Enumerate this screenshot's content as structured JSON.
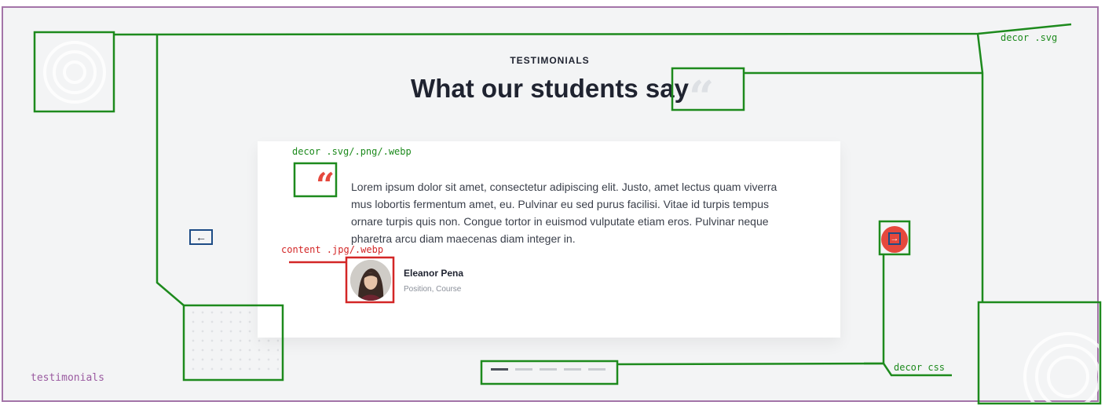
{
  "section": {
    "eyebrow": "TESTIMONIALS",
    "heading": "What our students say",
    "label": "testimonials"
  },
  "testimonial": {
    "quote_mark": "“",
    "text": "Lorem ipsum dolor sit amet, consectetur adipiscing elit. Justo, amet lectus quam viverra mus lobortis fermentum amet, eu. Pulvinar eu sed purus facilisi. Vitae id turpis tempus ornare turpis quis non. Congue tortor in euismod vulputate etiam eros. Pulvinar neque pharetra arcu diam maecenas diam integer in.",
    "author_name": "Eleanor Pena",
    "author_role": "Position, Course"
  },
  "nav": {
    "prev_icon": "←",
    "next_icon": "→"
  },
  "pager": {
    "count": 5,
    "active_index": 0
  },
  "annotations": {
    "decor_svg": "decor .svg",
    "decor_svg_png_webp": "decor .svg/.png/.webp",
    "content_jpg_webp": "content .jpg/.webp",
    "decor_css": "decor css"
  },
  "icons": {
    "ring_decor": "concentric-rings-icon",
    "quote_decor": "quote-icon",
    "dot_grid": "dot-grid-pattern",
    "arrow_left": "arrow-left-icon",
    "arrow_right": "arrow-right-icon"
  },
  "colors": {
    "accent": "#e5483d",
    "heading": "#1f2330",
    "body_text": "#3a3f4a",
    "muted_text": "#8a8f99",
    "background": "#f3f4f5",
    "frame_border": "#a374a8",
    "annotation_green": "#1d8a1d",
    "annotation_red": "#d32626",
    "annotation_blue": "#1d4c86"
  }
}
